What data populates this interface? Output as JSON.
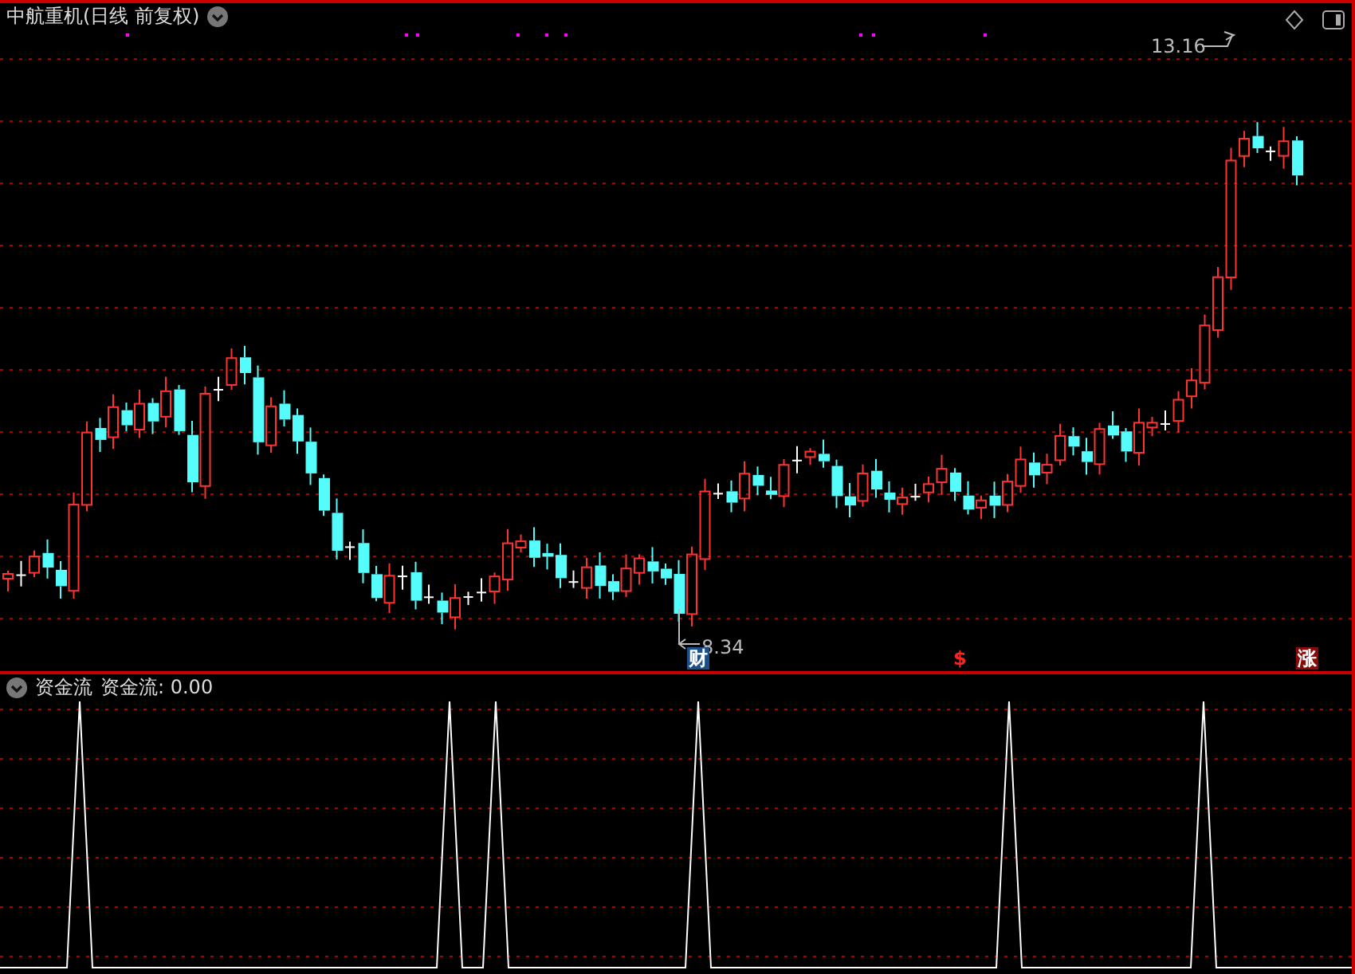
{
  "title": "中航重机(日线 前复权)",
  "price_chart": {
    "high_label": "13.16",
    "low_label": "8.34",
    "markers": [
      {
        "kind": "finance",
        "text": "财"
      },
      {
        "kind": "dollar",
        "text": "$"
      },
      {
        "kind": "limit_up",
        "text": "涨"
      }
    ]
  },
  "indicator": {
    "name": "资金流",
    "reading": "资金流: 0.00"
  }
}
